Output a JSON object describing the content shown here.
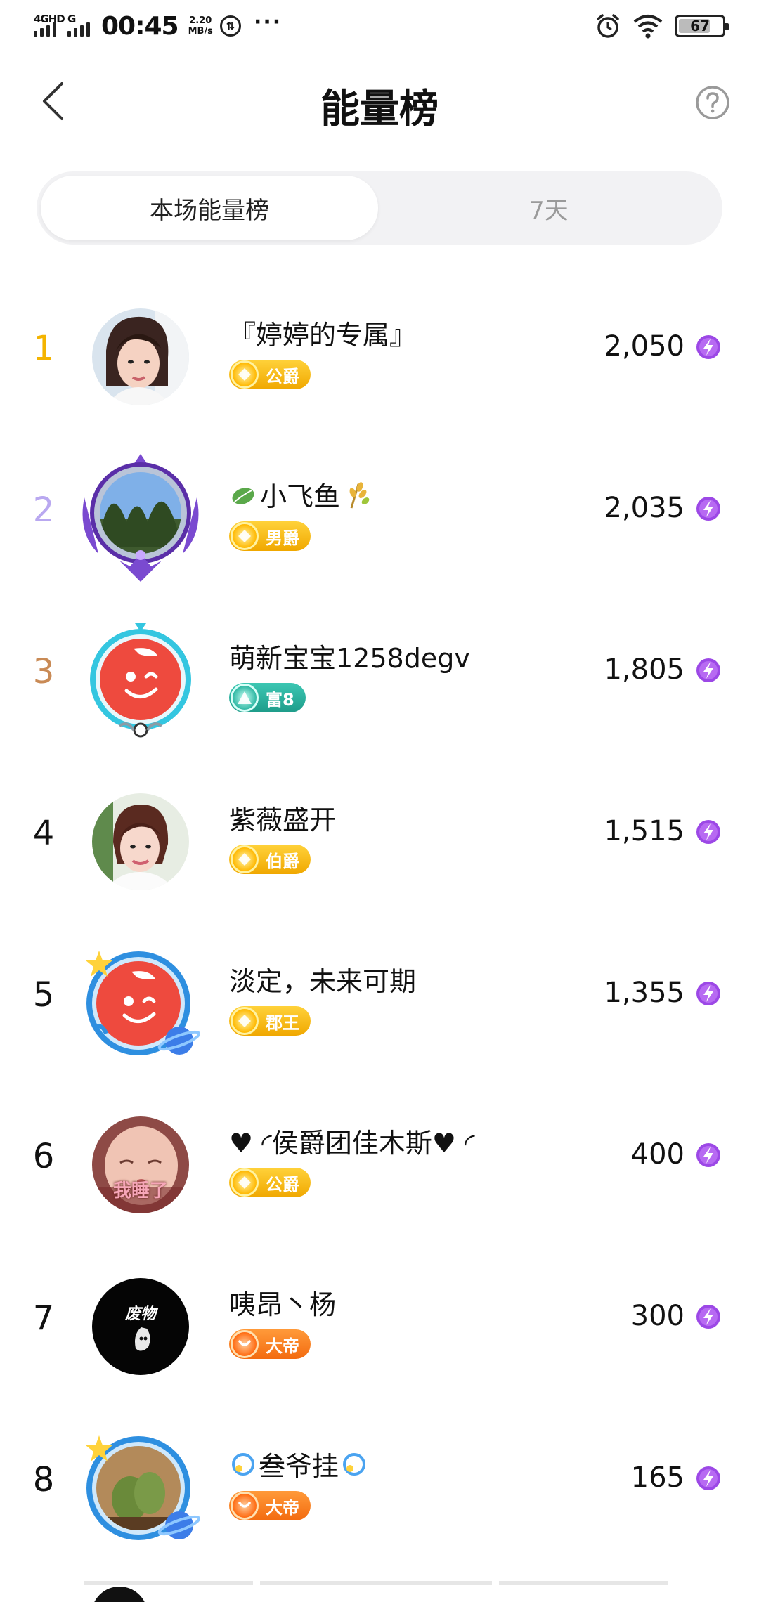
{
  "status_bar": {
    "network1": "4GHD",
    "network2": "G",
    "time": "00:45",
    "speed_value": "2.20",
    "speed_unit": "MB/s",
    "battery": "67"
  },
  "header": {
    "title": "能量榜"
  },
  "tabs": [
    {
      "label": "本场能量榜",
      "active": true
    },
    {
      "label": "7天",
      "active": false
    }
  ],
  "colors": {
    "rank1": "#f4b400",
    "rank2": "#b9a8f0",
    "rank3": "#c98a55",
    "energy": "#8e3ee0"
  },
  "ranking": [
    {
      "rank": "1",
      "name": "『婷婷的专属』",
      "badge": "公爵",
      "badge_style": "gold",
      "score": "2,050",
      "avatar": "photo-woman"
    },
    {
      "rank": "2",
      "name": "小飞鱼",
      "name_icons": [
        "leaf-icon",
        "wheat-icon"
      ],
      "badge": "男爵",
      "badge_style": "gold",
      "score": "2,035",
      "avatar": "trees-photo-frame"
    },
    {
      "rank": "3",
      "name": "萌新宝宝1258degv",
      "badge": "富8",
      "badge_style": "teal",
      "score": "1,805",
      "avatar": "default-red"
    },
    {
      "rank": "4",
      "name": "紫薇盛开",
      "badge": "伯爵",
      "badge_style": "gold",
      "score": "1,515",
      "avatar": "photo-woman"
    },
    {
      "rank": "5",
      "name": "淡定，未来可期",
      "badge": "郡王",
      "badge_style": "gold",
      "score": "1,355",
      "avatar": "default-red-frame"
    },
    {
      "rank": "6",
      "name": "♥ ◜侯爵团佳木斯♥ ◜",
      "badge": "公爵",
      "badge_style": "gold",
      "score": "400",
      "avatar": "photo-baby",
      "avatar_text": "我睡了"
    },
    {
      "rank": "7",
      "name": "咦昂丶杨",
      "badge": "大帝",
      "badge_style": "orange",
      "score": "300",
      "avatar": "black-ghost",
      "avatar_text": "废物"
    },
    {
      "rank": "8",
      "name": "叁爷挂",
      "badge": "大帝",
      "badge_style": "orange",
      "score": "165",
      "avatar": "gourd-photo-frame"
    }
  ]
}
